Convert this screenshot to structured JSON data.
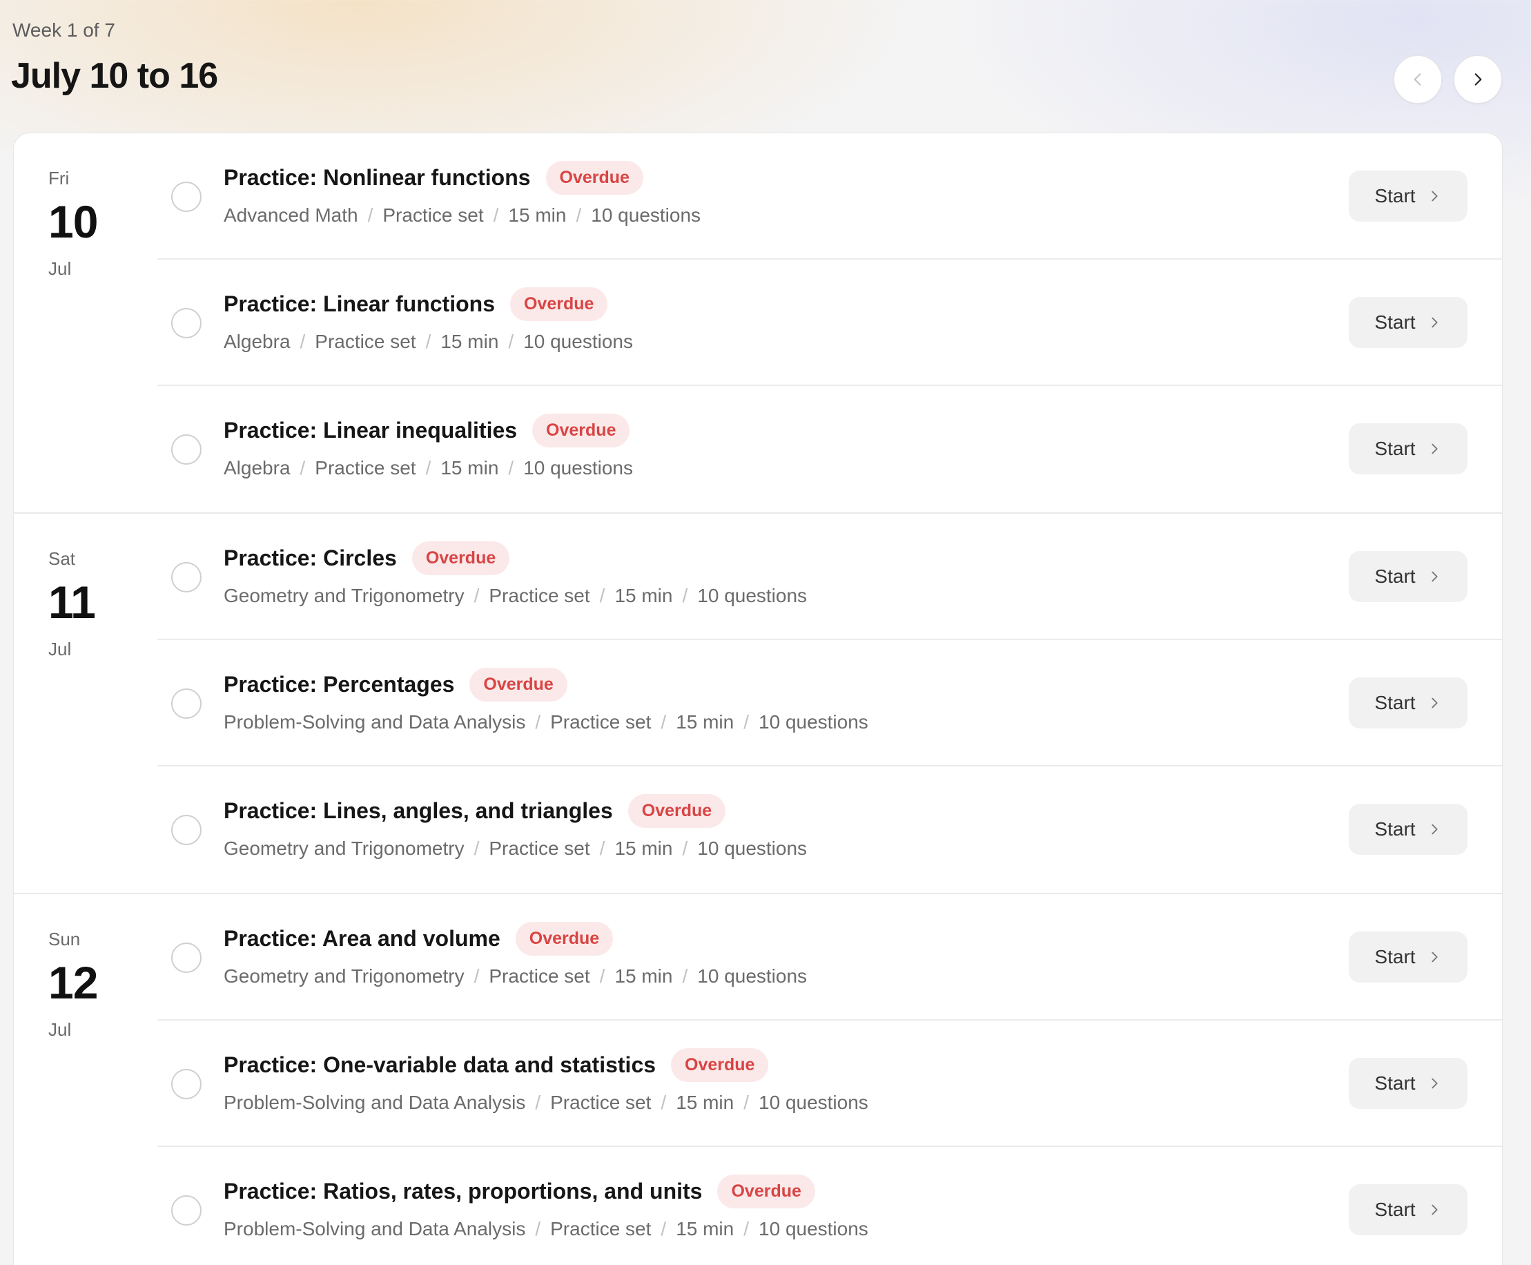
{
  "header": {
    "week_label": "Week 1 of 7",
    "title": "July 10 to 16",
    "prev_icon": "chevron-left-icon",
    "next_icon": "chevron-right-icon"
  },
  "days": [
    {
      "dow": "Fri",
      "num": "10",
      "month": "Jul",
      "tasks": [
        {
          "title": "Practice: Nonlinear functions",
          "badge": "Overdue",
          "meta": [
            "Advanced Math",
            "Practice set",
            "15 min",
            "10 questions"
          ],
          "button": "Start"
        },
        {
          "title": "Practice: Linear functions",
          "badge": "Overdue",
          "meta": [
            "Algebra",
            "Practice set",
            "15 min",
            "10 questions"
          ],
          "button": "Start"
        },
        {
          "title": "Practice: Linear inequalities",
          "badge": "Overdue",
          "meta": [
            "Algebra",
            "Practice set",
            "15 min",
            "10 questions"
          ],
          "button": "Start"
        }
      ]
    },
    {
      "dow": "Sat",
      "num": "11",
      "month": "Jul",
      "tasks": [
        {
          "title": "Practice: Circles",
          "badge": "Overdue",
          "meta": [
            "Geometry and Trigonometry",
            "Practice set",
            "15 min",
            "10 questions"
          ],
          "button": "Start"
        },
        {
          "title": "Practice: Percentages",
          "badge": "Overdue",
          "meta": [
            "Problem-Solving and Data Analysis",
            "Practice set",
            "15 min",
            "10 questions"
          ],
          "button": "Start"
        },
        {
          "title": "Practice: Lines, angles, and triangles",
          "badge": "Overdue",
          "meta": [
            "Geometry and Trigonometry",
            "Practice set",
            "15 min",
            "10 questions"
          ],
          "button": "Start"
        }
      ]
    },
    {
      "dow": "Sun",
      "num": "12",
      "month": "Jul",
      "tasks": [
        {
          "title": "Practice: Area and volume",
          "badge": "Overdue",
          "meta": [
            "Geometry and Trigonometry",
            "Practice set",
            "15 min",
            "10 questions"
          ],
          "button": "Start"
        },
        {
          "title": "Practice: One-variable data and statistics",
          "badge": "Overdue",
          "meta": [
            "Problem-Solving and Data Analysis",
            "Practice set",
            "15 min",
            "10 questions"
          ],
          "button": "Start"
        },
        {
          "title": "Practice: Ratios, rates, proportions, and units",
          "badge": "Overdue",
          "meta": [
            "Problem-Solving and Data Analysis",
            "Practice set",
            "15 min",
            "10 questions"
          ],
          "button": "Start"
        }
      ]
    }
  ],
  "colors": {
    "badge_bg": "#fbe9e9",
    "badge_text": "#d94444",
    "button_bg": "#f1f1f2"
  }
}
